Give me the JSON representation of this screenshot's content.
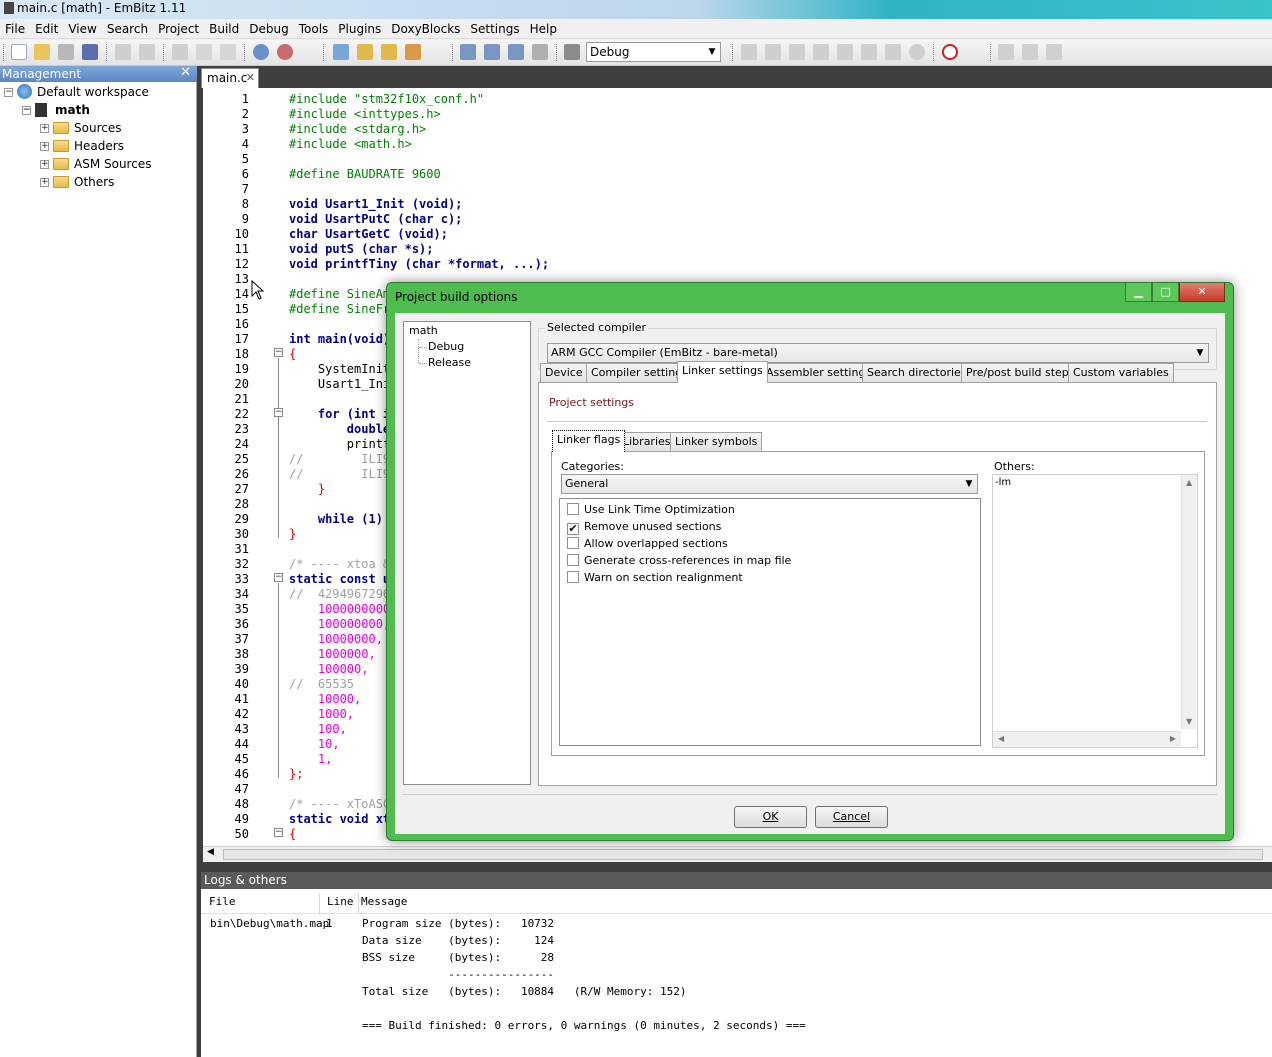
{
  "window": {
    "title": "main.c [math] - EmBitz 1.11"
  },
  "menu": [
    "File",
    "Edit",
    "View",
    "Search",
    "Project",
    "Build",
    "Debug",
    "Tools",
    "Plugins",
    "DoxyBlocks",
    "Settings",
    "Help"
  ],
  "toolbar": {
    "build_target": "Debug"
  },
  "management": {
    "title": "Management",
    "tree": {
      "workspace": "Default workspace",
      "project": "math",
      "folders": [
        "Sources",
        "Headers",
        "ASM Sources",
        "Others"
      ]
    }
  },
  "editor": {
    "tab": "main.c",
    "line_numbers": [
      "1",
      "2",
      "3",
      "4",
      "5",
      "6",
      "7",
      "8",
      "9",
      "10",
      "11",
      "12",
      "13",
      "14",
      "15",
      "16",
      "17",
      "18",
      "19",
      "20",
      "21",
      "22",
      "23",
      "24",
      "25",
      "26",
      "27",
      "28",
      "29",
      "30",
      "31",
      "32",
      "33",
      "34",
      "35",
      "36",
      "37",
      "38",
      "39",
      "40",
      "41",
      "42",
      "43",
      "44",
      "45",
      "46",
      "47",
      "48",
      "49",
      "50"
    ],
    "lines": [
      "#include \"stm32f10x_conf.h\"",
      "#include <inttypes.h>",
      "#include <stdarg.h>",
      "#include <math.h>",
      "",
      "#define BAUDRATE 9600",
      "",
      "void Usart1_Init (void);",
      "void UsartPutC (char c);",
      "char UsartGetC (void);",
      "void putS (char *s);",
      "void printfTiny (char *format, ...);",
      "",
      "#define SineAm",
      "#define SineFr",
      "",
      "int main(void)",
      "{",
      "    SystemInit",
      "    Usart1_Ini",
      "",
      "    for (int i",
      "        double",
      "        printf",
      "//        ILI9",
      "//        ILI9",
      "    }",
      "",
      "    while (1)",
      "}",
      "",
      "/* ---- xtoa &",
      "static const u",
      "//  4294967296",
      "    1000000000",
      "    100000000,",
      "    10000000,",
      "    1000000,",
      "    100000,",
      "//  65535",
      "    10000,",
      "    1000,",
      "    100,",
      "    10,",
      "    1,",
      "};",
      "",
      "/* ---- xToASC",
      "static void xt",
      "{"
    ]
  },
  "logs": {
    "title": "Logs & others",
    "columns": [
      "File",
      "Line",
      "Message"
    ],
    "file": "bin\\Debug\\math.map",
    "line": "1",
    "messages": [
      "Program size (bytes):   10732",
      "Data size    (bytes):     124",
      "BSS size     (bytes):      28",
      "             ----------------",
      "Total size   (bytes):   10884   (R/W Memory: 152)",
      "",
      "=== Build finished: 0 errors, 0 warnings (0 minutes, 2 seconds) ==="
    ]
  },
  "dialog": {
    "title": "Project build options",
    "targets": {
      "project": "math",
      "items": [
        "Debug",
        "Release"
      ]
    },
    "selected_compiler_label": "Selected compiler",
    "compiler": "ARM GCC Compiler (EmBitz - bare-metal)",
    "tabs": [
      "Device",
      "Compiler settings",
      "Linker settings",
      "Assembler settings",
      "Search directories",
      "Pre/post build steps",
      "Custom variables"
    ],
    "active_tab": "Linker settings",
    "project_settings": "Project settings",
    "subtabs": [
      "Linker flags",
      "Libraries",
      "Linker symbols"
    ],
    "categories_label": "Categories:",
    "category": "General",
    "options": [
      {
        "label": "Use Link Time Optimization",
        "checked": false
      },
      {
        "label": "Remove unused sections",
        "checked": true
      },
      {
        "label": "Allow overlapped sections",
        "checked": false
      },
      {
        "label": "Generate cross-references in map file",
        "checked": false
      },
      {
        "label": "Warn on section realignment",
        "checked": false
      }
    ],
    "others_label": "Others:",
    "others_value": "-lm",
    "ok": "OK",
    "cancel": "Cancel"
  }
}
